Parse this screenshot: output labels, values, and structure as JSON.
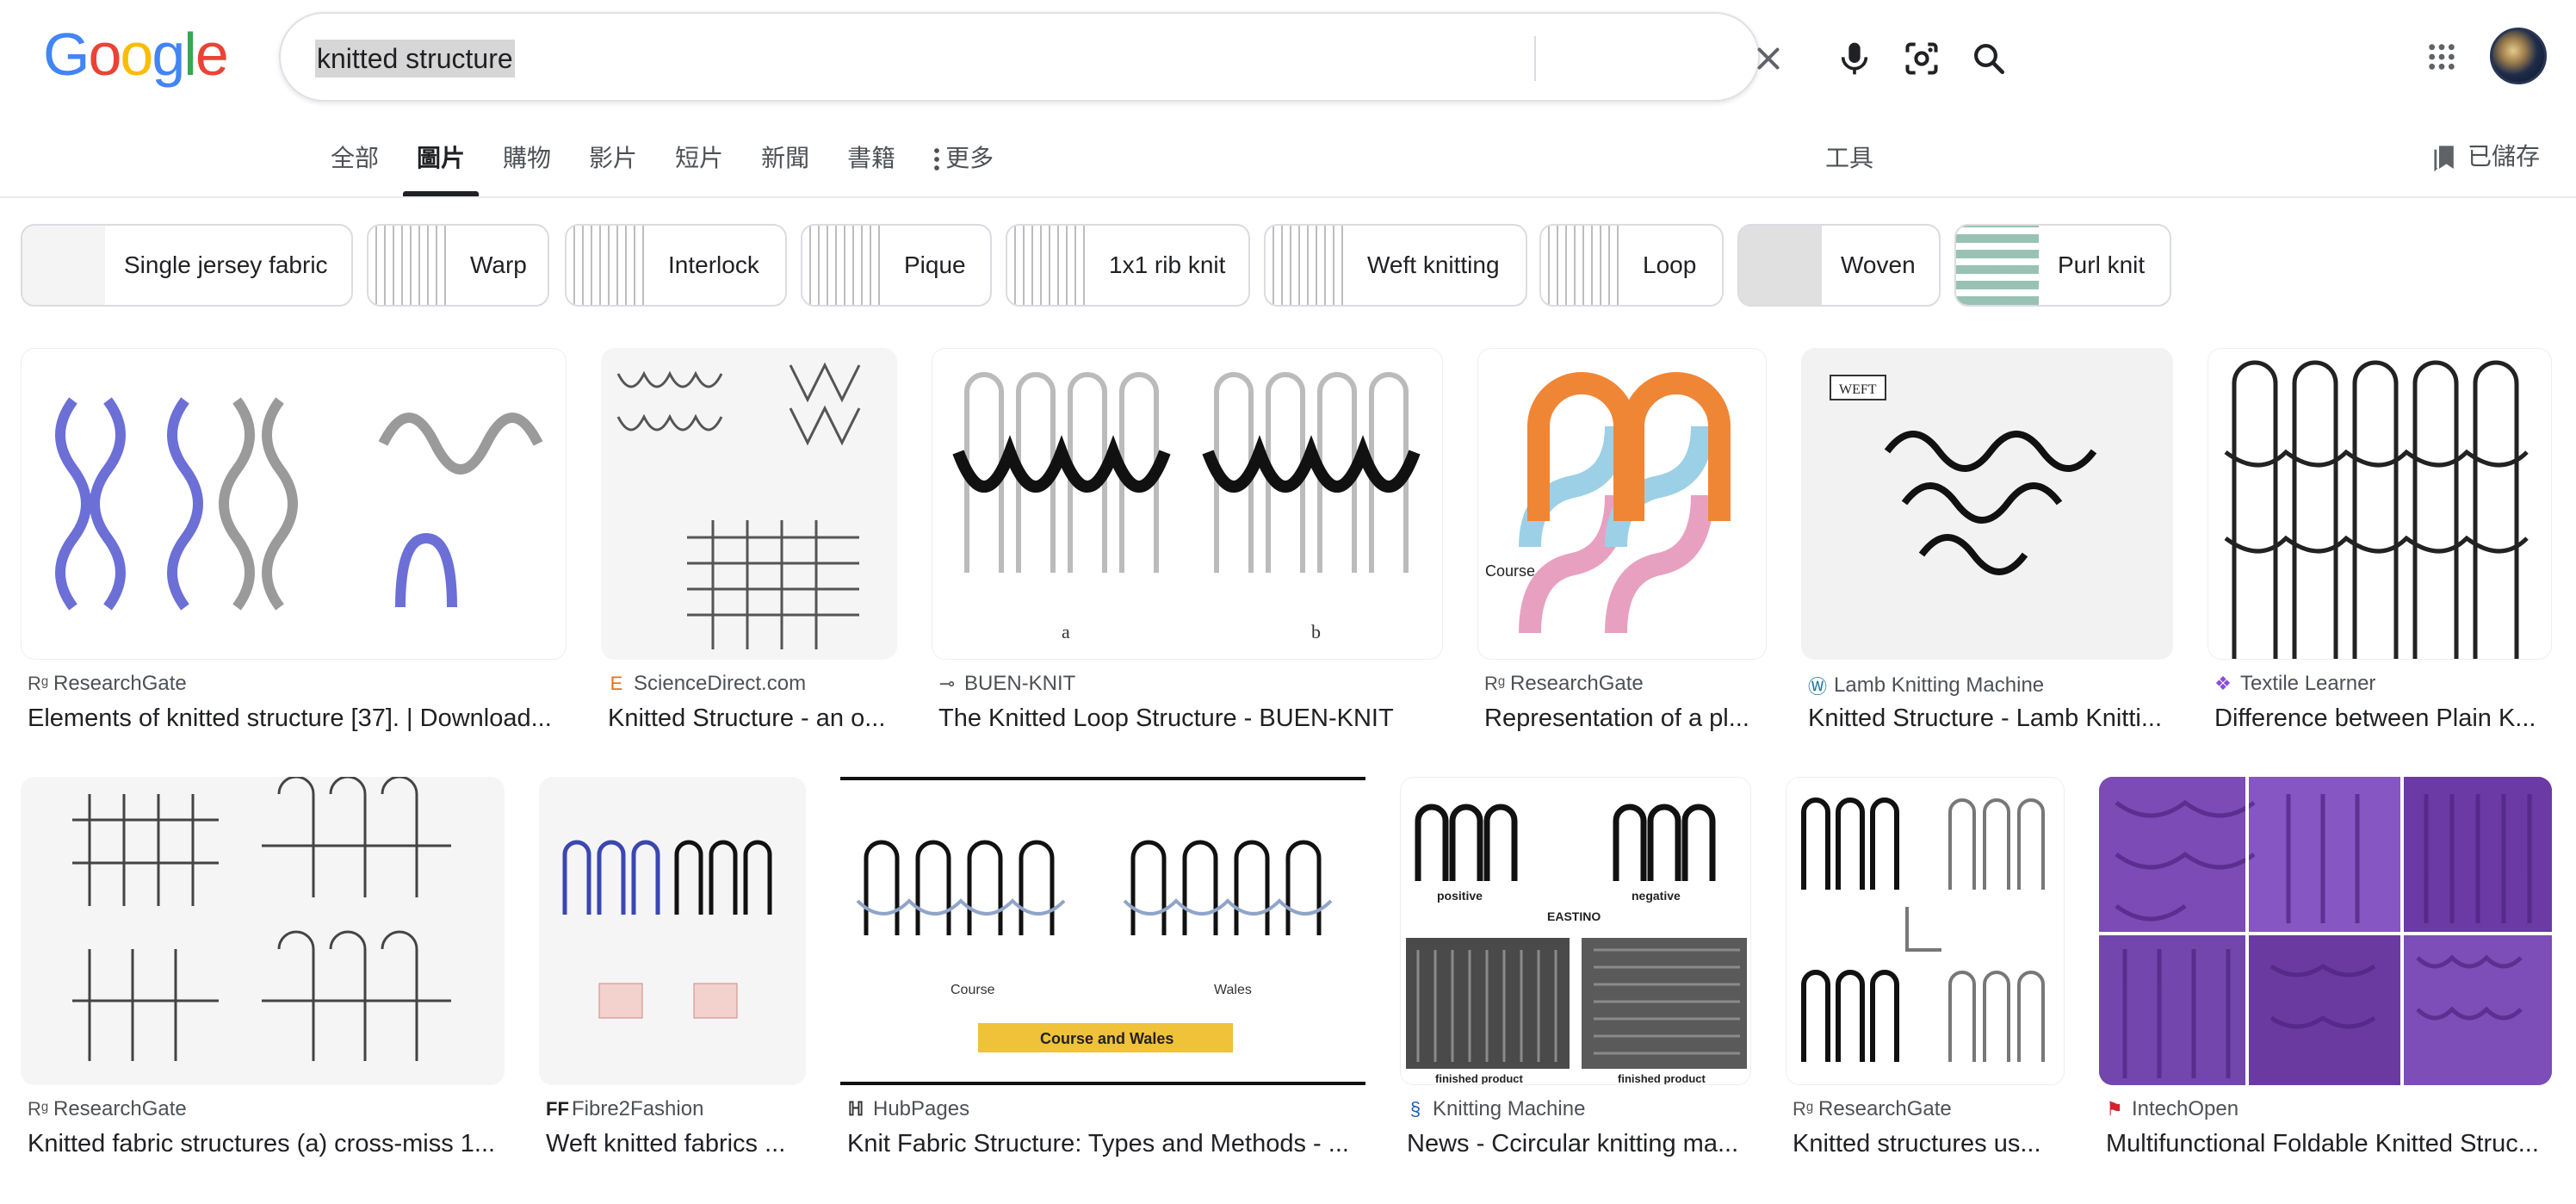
{
  "search": {
    "query": "knitted structure"
  },
  "logo": {
    "text": "Google",
    "letters": [
      {
        "ch": "G",
        "color": "#4285F4"
      },
      {
        "ch": "o",
        "color": "#EA4335"
      },
      {
        "ch": "o",
        "color": "#FBBC05"
      },
      {
        "ch": "g",
        "color": "#4285F4"
      },
      {
        "ch": "l",
        "color": "#34A853"
      },
      {
        "ch": "e",
        "color": "#EA4335"
      }
    ]
  },
  "tabs": [
    "全部",
    "圖片",
    "購物",
    "影片",
    "短片",
    "新聞",
    "書籍"
  ],
  "tab_more": "更多",
  "tools": "工具",
  "saved": "已儲存",
  "chips": [
    "Single jersey fabric",
    "Warp",
    "Interlock",
    "Pique",
    "1x1 rib knit",
    "Weft knitting",
    "Loop",
    "Woven",
    "Purl knit"
  ],
  "results": [
    {
      "source": "ResearchGate",
      "title": "Elements of knitted structure [37]. | Download..."
    },
    {
      "source": "ScienceDirect.com",
      "title": "Knitted Structure - an o..."
    },
    {
      "source": "BUEN-KNIT",
      "title": "The Knitted Loop Structure - BUEN-KNIT"
    },
    {
      "source": "ResearchGate",
      "title": "Representation of a pl..."
    },
    {
      "source": "Lamb Knitting Machine",
      "title": "Knitted Structure - Lamb Knitti..."
    },
    {
      "source": "Textile Learner",
      "title": "Difference between Plain K..."
    },
    {
      "source": "ResearchGate",
      "title": "Knitted fabric structures (a) cross-miss 1..."
    },
    {
      "source": "Fibre2Fashion",
      "title": "Weft knitted fabrics ..."
    },
    {
      "source": "HubPages",
      "title": "Knit Fabric Structure: Types and Methods - ..."
    },
    {
      "source": "Knitting Machine",
      "title": "News - Ccircular knitting ma..."
    },
    {
      "source": "ResearchGate",
      "title": "Knitted structures us..."
    },
    {
      "source": "IntechOpen",
      "title": "Multifunctional Foldable Knitted Struc..."
    }
  ],
  "image_text": {
    "r1_a": "a",
    "r1_b": "b",
    "course_label": "Course",
    "wales_label": "Wales",
    "course_and_wales": "Course and Wales",
    "eastino": "EASTINO",
    "positive": "positive",
    "negative": "negative",
    "finished_product": "finished product",
    "weft": "WEFT"
  },
  "colors": {
    "accent": "#1a73e8",
    "tab_text": "#4d5156",
    "text": "#202124"
  }
}
